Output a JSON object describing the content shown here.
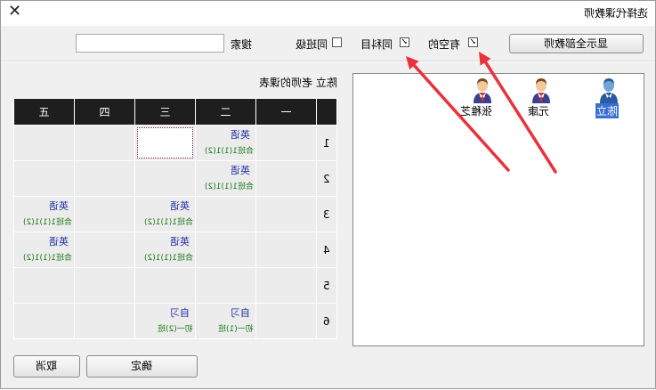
{
  "window": {
    "title": "选择代课教师",
    "close_glyph": "✕"
  },
  "toolbar": {
    "show_all_button": "显示全部教师",
    "free_label": "有空的",
    "same_subject_label": "同科目",
    "same_grade_label": "同班级",
    "search_label": "搜索",
    "search_value": "",
    "checkmark": "✓"
  },
  "schedule": {
    "title": "陈立 老师的课表",
    "headers": [
      "五",
      "四",
      "三",
      "二",
      "一"
    ],
    "rows": [
      {
        "no": "1",
        "cells": [
          {},
          {},
          {
            "selected": true
          },
          {
            "subject": "英语",
            "class": "合班1(1)1(2)"
          },
          {}
        ]
      },
      {
        "no": "2",
        "cells": [
          {},
          {},
          {},
          {
            "subject": "英语",
            "class": "合班1(1)1(2)"
          },
          {}
        ]
      },
      {
        "no": "3",
        "cells": [
          {
            "subject": "英语",
            "class": "合班1(1)1(2)"
          },
          {},
          {
            "subject": "英语",
            "class": "合班1(1)1(2)"
          },
          {},
          {}
        ]
      },
      {
        "no": "4",
        "cells": [
          {
            "subject": "英语",
            "class": "合班1(1)1(2)"
          },
          {},
          {
            "subject": "英语",
            "class": "合班1(1)1(2)"
          },
          {},
          {}
        ]
      },
      {
        "no": "5",
        "cells": [
          {},
          {},
          {},
          {},
          {}
        ]
      },
      {
        "no": "6",
        "cells": [
          {},
          {},
          {
            "subject": "自习",
            "class": "初一(2)班"
          },
          {
            "subject": "自习",
            "class": "初一(1)班"
          },
          {}
        ]
      }
    ]
  },
  "teachers": [
    {
      "name": "陈立",
      "selected": true
    },
    {
      "name": "元康",
      "selected": false
    },
    {
      "name": "张稚芝",
      "selected": false
    }
  ],
  "footer": {
    "ok_button": "确定",
    "cancel_button": "取消"
  },
  "colors": {
    "arrow": "#e8323c",
    "header_bg": "#1e1e1e",
    "subject": "#1d2ca5",
    "class": "#1d7a1d",
    "selection": "#3a6fd4"
  }
}
